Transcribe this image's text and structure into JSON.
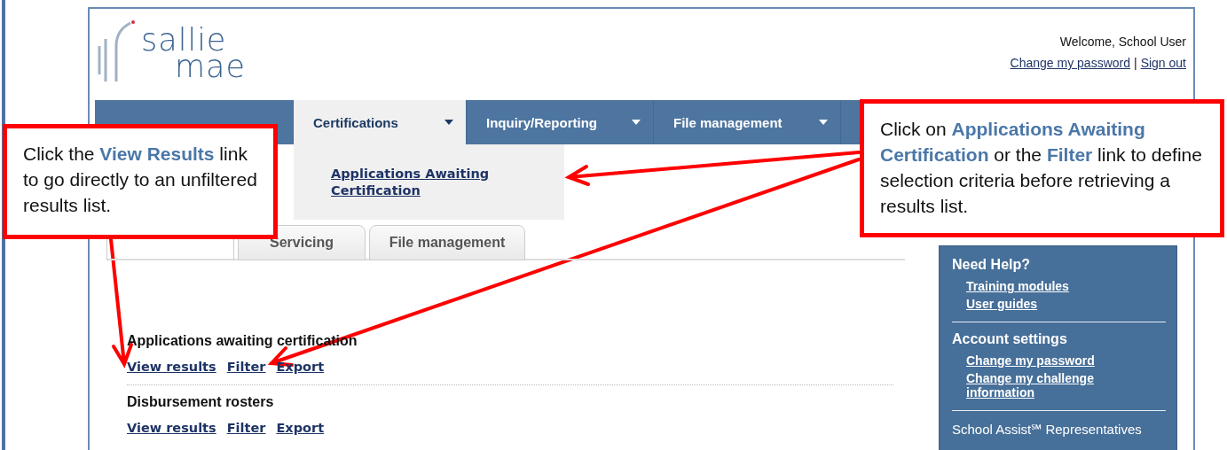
{
  "header": {
    "logo_words": [
      "sallie",
      "mae"
    ],
    "welcome": "Welcome, School User",
    "links": [
      "Change my password",
      "Sign out"
    ],
    "separator": "|"
  },
  "nav": [
    {
      "label": "Certifications",
      "selected": true,
      "dropdown": true
    },
    {
      "label": "Inquiry/Reporting",
      "selected": false,
      "dropdown": true
    },
    {
      "label": "File management",
      "selected": false,
      "dropdown": true
    }
  ],
  "dropdown_menu": {
    "items": [
      "Applications Awaiting Certification"
    ]
  },
  "subtabs": [
    {
      "selected": true
    },
    {
      "label": "Servicing",
      "selected": false
    },
    {
      "label": "File management",
      "selected": false
    }
  ],
  "sections": [
    {
      "title": "Applications awaiting certification",
      "links": [
        "View results",
        "Filter",
        "Export"
      ]
    },
    {
      "title": "Disbursement rosters",
      "links": [
        "View results",
        "Filter",
        "Export"
      ]
    }
  ],
  "sidebar": {
    "groups": [
      {
        "title": "Need Help?",
        "links": [
          "Training modules",
          "User guides"
        ]
      },
      {
        "title": "Account settings",
        "links": [
          "Change my password",
          "Change my challenge information"
        ]
      }
    ],
    "note": "School Assist℠ Representatives"
  },
  "callouts": [
    {
      "text": "Click the **View Results** link to go directly to an unfiltered results list."
    },
    {
      "text": "Click on **Applications Awaiting Certification** or the **Filter** link to define selection criteria before retrieving a results list."
    }
  ]
}
